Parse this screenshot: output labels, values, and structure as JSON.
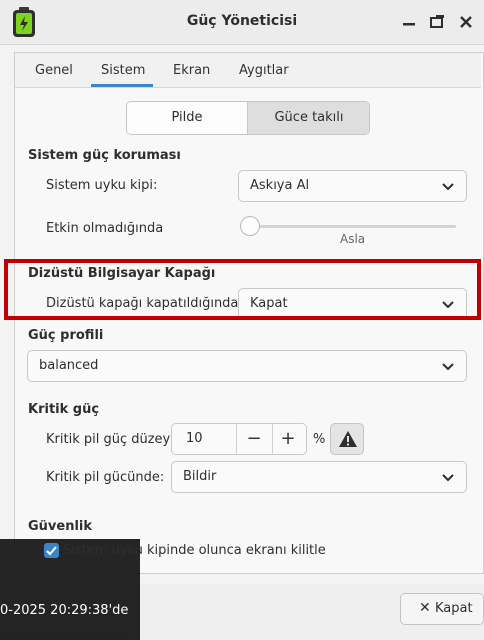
{
  "window": {
    "title": "Güç Yöneticisi"
  },
  "tabs": [
    {
      "label": "Genel"
    },
    {
      "label": "Sistem"
    },
    {
      "label": "Ekran"
    },
    {
      "label": "Aygıtlar"
    }
  ],
  "mode_toggle": {
    "battery": "Pilde",
    "plugged": "Güce takılı"
  },
  "system_power": {
    "heading": "Sistem güç koruması",
    "sleep_mode_label": "Sistem uyku kipi:",
    "sleep_mode_value": "Askıya Al",
    "inactivity_label": "Etkin olmadığında",
    "inactivity_value": "Asla"
  },
  "lid": {
    "heading": "Dizüstü Bilgisayar Kapağı",
    "lid_close_label": "Dizüstü kapağı kapatıldığında:",
    "lid_close_value": "Kapat"
  },
  "power_profile": {
    "heading": "Güç profili",
    "value": "balanced"
  },
  "critical": {
    "heading": "Kritik güç",
    "level_label": "Kritik pil güç düzeyi:",
    "level_value": "10",
    "minus": "−",
    "plus": "+",
    "unit": "%",
    "action_label": "Kritik pil gücünde:",
    "action_value": "Bildir"
  },
  "security": {
    "heading": "Güvenlik",
    "lock_label": "Sistem uyku kipinde olunca ekranı kilitle",
    "lock_checked": true
  },
  "overlay": {
    "text": "0-2025 20:29:38'de"
  },
  "footer": {
    "close_label": "Kapat"
  },
  "colors": {
    "accent": "#3d86c6",
    "highlight": "#c00000"
  }
}
